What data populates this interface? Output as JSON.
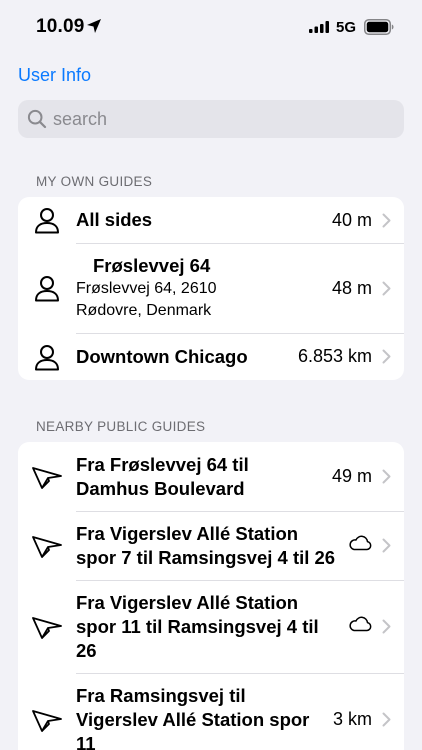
{
  "status_bar": {
    "time": "10.09",
    "network": "5G"
  },
  "nav": {
    "back_label": "User Info"
  },
  "search": {
    "placeholder": "search"
  },
  "own_guides": {
    "header": "MY OWN GUIDES",
    "items": [
      {
        "title": "All sides",
        "distance": "40 m"
      },
      {
        "title": "Frøslevvej 64",
        "address_line1": "Frøslevvej 64, 2610",
        "address_line2": "Rødovre, Denmark",
        "distance": "48 m"
      },
      {
        "title": "Downtown Chicago",
        "distance": "6.853 km"
      }
    ]
  },
  "public_guides": {
    "header": "NEARBY PUBLIC GUIDES",
    "items": [
      {
        "line1": "Fra Frøslevvej 64 til",
        "line2": "Damhus Boulevard",
        "distance": "49 m"
      },
      {
        "line1": "Fra Vigerslev Allé Station",
        "line2": "spor 7 til Ramsingsvej 4 til 26",
        "trailing_icon": "cloud-icon"
      },
      {
        "line1": "Fra Vigerslev Allé Station",
        "line2": "spor 11 til Ramsingsvej 4 til",
        "line3": "26",
        "trailing_icon": "cloud-icon"
      },
      {
        "line1": "Fra Ramsingsvej til",
        "line2": "Vigerslev Allé Station spor",
        "line3": "11",
        "distance": "3 km"
      }
    ]
  },
  "colors": {
    "accent": "#0a7aff",
    "background": "#f2f2f7",
    "separator": "#dedee3"
  }
}
